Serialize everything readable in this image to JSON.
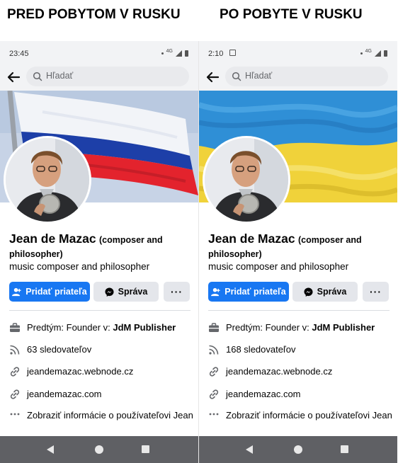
{
  "headings": {
    "left": "PRED POBYTOM V RUSKU",
    "right": "PO POBYTE V RUSKU"
  },
  "panels": [
    {
      "time": "23:45",
      "network": "4G",
      "search_placeholder": "Hľadať",
      "cover_flag": "russian-flag",
      "colors": {
        "stripe1": "#f2f4f8",
        "stripe2": "#1d3fa8",
        "stripe3": "#e3232d"
      },
      "name_main": "Jean de Mazac",
      "name_suffix": "(composer and philosopher)",
      "bio": "music composer and philosopher",
      "add_friend": "Pridať priateľa",
      "message": "Správa",
      "more": "···",
      "work_prefix": "Predtým: Founder v: ",
      "work_company": "JdM Publisher",
      "followers": "63 sledovateľov",
      "link1": "jeandemazac.webnode.cz",
      "link2": "jeandemazac.com",
      "about": "Zobraziť informácie o používateľovi Jean"
    },
    {
      "time": "2:10",
      "network": "4G",
      "search_placeholder": "Hľadať",
      "cover_flag": "ukrainian-flag",
      "colors": {
        "stripe1": "#2f8fd6",
        "stripe2": "#f0d23a"
      },
      "name_main": "Jean de Mazac",
      "name_suffix": "(composer and philosopher)",
      "bio": "music composer and philosopher",
      "add_friend": "Pridať priateľa",
      "message": "Správa",
      "more": "···",
      "work_prefix": "Predtým: Founder v: ",
      "work_company": "JdM Publisher",
      "followers": "168 sledovateľov",
      "link1": "jeandemazac.webnode.cz",
      "link2": "jeandemazac.com",
      "about": "Zobraziť informácie o používateľovi Jean"
    }
  ],
  "accent": "#1877f2"
}
